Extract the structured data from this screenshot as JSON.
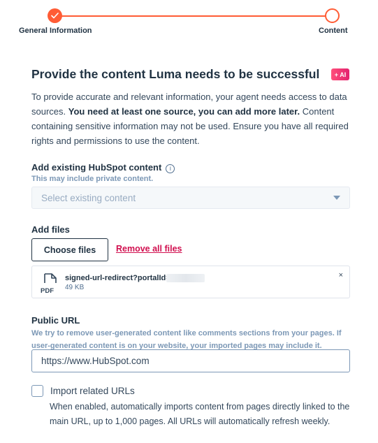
{
  "stepper": {
    "steps": [
      {
        "label": "General Information",
        "state": "completed"
      },
      {
        "label": "Content",
        "state": "current"
      }
    ],
    "accent_color": "#ff5c35"
  },
  "header": {
    "title": "Provide the content Luma needs to be successful",
    "ai_badge": "+ AI"
  },
  "intro": {
    "text_before": "To provide accurate and relevant information, your agent needs access to data sources. ",
    "text_bold": "You need at least one source, you can add more later.",
    "text_after": " Content containing sensitive information may not be used. Ensure you have all required rights and permissions to use the content."
  },
  "existing_content": {
    "label": "Add existing HubSpot content",
    "info_icon": "info-icon",
    "help": "This may include private content.",
    "select_placeholder": "Select existing content"
  },
  "files": {
    "label": "Add files",
    "choose_label": "Choose files",
    "remove_all_label": "Remove all files",
    "items": [
      {
        "name": "signed-url-redirect?portalId=",
        "type": "PDF",
        "size": "49 KB",
        "close": "×"
      }
    ]
  },
  "public_url": {
    "label": "Public URL",
    "help": "We try to remove user-generated content like comments sections from your pages. If user-generated content is on your website, your imported pages may include it.",
    "value": "https://www.HubSpot.com"
  },
  "import_related": {
    "label": "Import related URLs",
    "checked": false,
    "description": "When enabled, automatically imports content from pages directly linked to the main URL, up to 1,000 pages. All URLs will automatically refresh weekly."
  }
}
